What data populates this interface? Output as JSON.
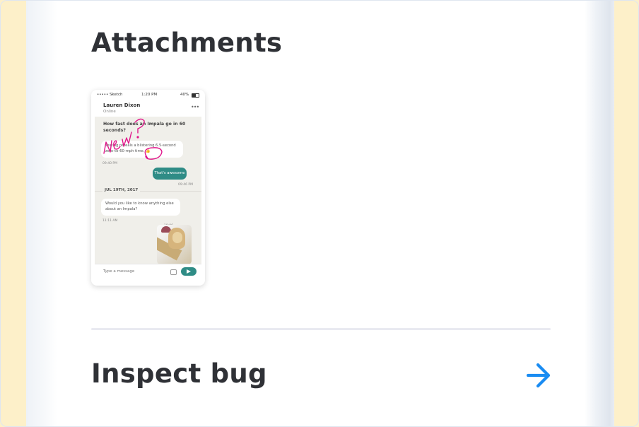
{
  "section": {
    "title": "Attachments"
  },
  "attachment": {
    "status_bar": {
      "carrier": "••••• Sketch",
      "time": "1:20 PM",
      "battery": "40%"
    },
    "header": {
      "name": "Lauren Dixon",
      "status": "Online"
    },
    "messages": {
      "question": "How fast does an Impala go in 60 seconds?",
      "reply": "Testing reveals a blistering 6.5-second zero-to-60-mph time. 👍",
      "reply_time": "09:40 PM",
      "sent": "That's awesome",
      "sent_time": "09:46 PM",
      "date_divider": "JUL 19TH, 2017",
      "followup": "Would you like to know anything else about an Impala?",
      "followup_time": "11:11 AM",
      "photo_time": "19:06"
    },
    "composer_placeholder": "Type a message",
    "annotation": "New?"
  },
  "inspect": {
    "label": "Inspect bug"
  },
  "colors": {
    "accent": "#1a8cf2",
    "chat_teal": "#2f8c86",
    "annotation": "#e0168a"
  },
  "icons": {
    "inspect_action": "arrow-right-icon"
  }
}
